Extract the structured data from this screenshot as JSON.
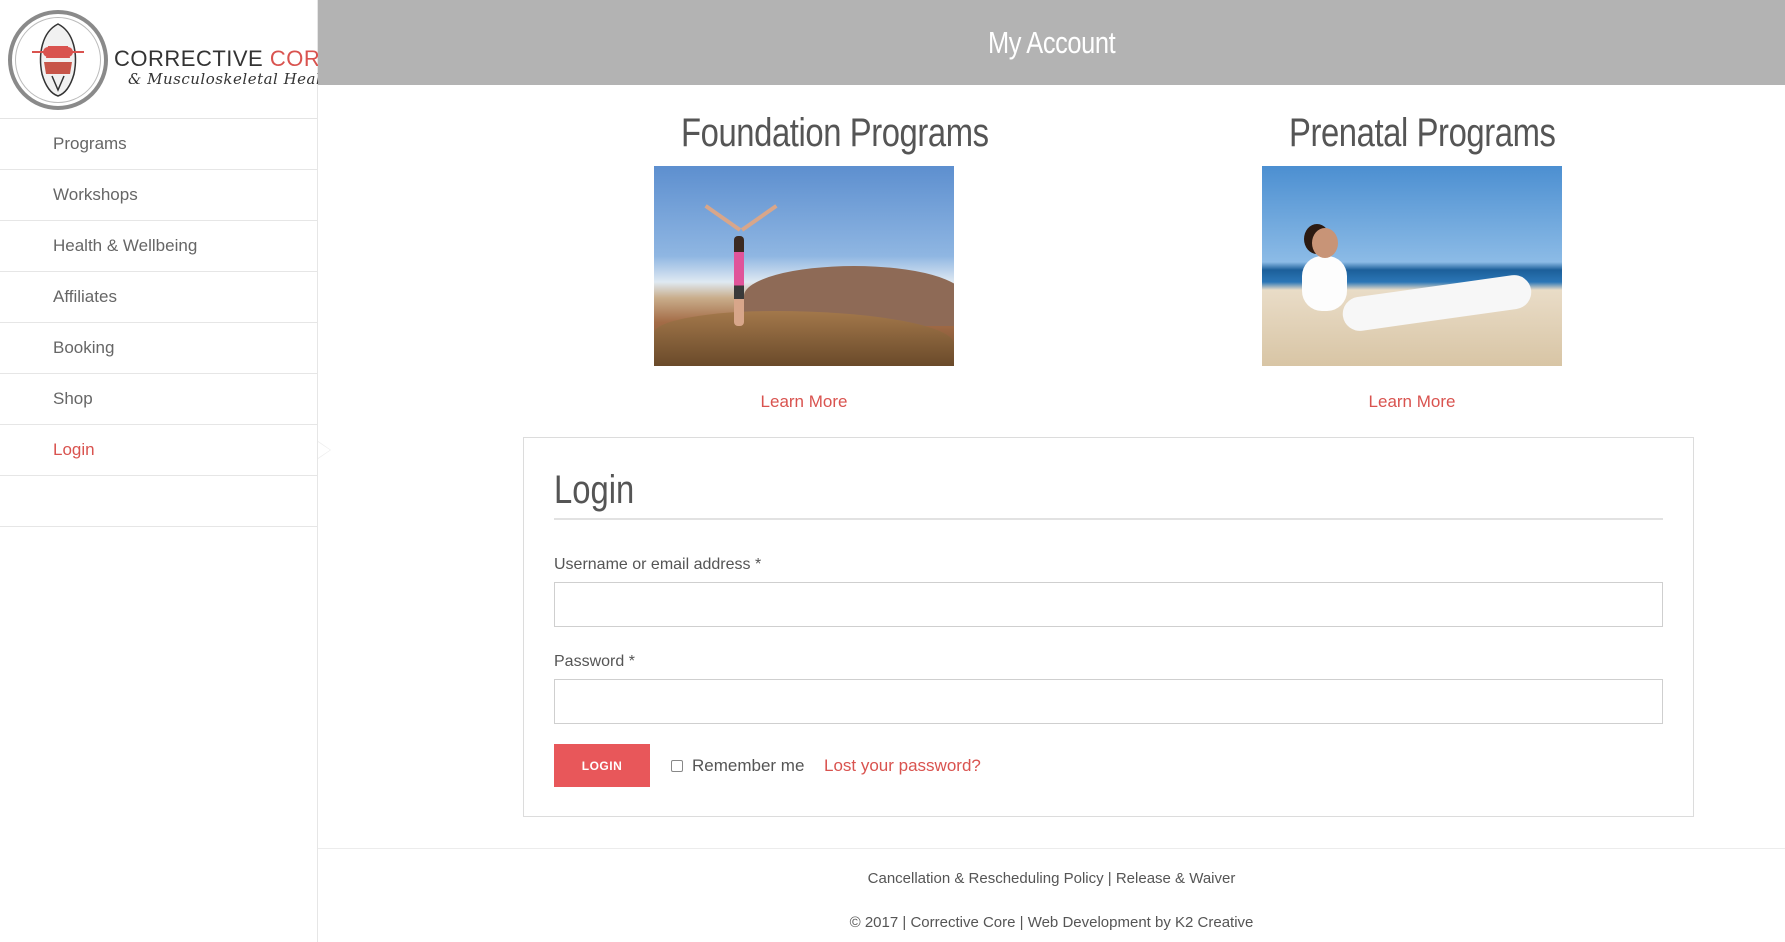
{
  "brand": {
    "name_part1": "CORRECTIVE ",
    "name_part2": "CORE",
    "tagline": "& Musculoskeletal Health"
  },
  "sidebar": {
    "items": [
      {
        "label": "Programs"
      },
      {
        "label": "Workshops"
      },
      {
        "label": "Health & Wellbeing"
      },
      {
        "label": "Affiliates"
      },
      {
        "label": "Booking"
      },
      {
        "label": "Shop"
      },
      {
        "label": "Login"
      }
    ],
    "active": "Login"
  },
  "header": {
    "title": "My Account"
  },
  "programs": [
    {
      "title": "Foundation Programs",
      "link": "Learn More"
    },
    {
      "title": "Prenatal Programs",
      "link": "Learn More"
    }
  ],
  "login": {
    "heading": "Login",
    "username_label": "Username or email address *",
    "username_value": "",
    "password_label": "Password *",
    "password_value": "",
    "button": "LOGIN",
    "remember": "Remember me",
    "lost": "Lost your password?"
  },
  "footer": {
    "link1": "Cancellation & Rescheduling Policy",
    "sep": " | ",
    "link2": "Release & Waiver",
    "copyright": "© 2017 | Corrective Core | Web Development by K2 Creative"
  },
  "colors": {
    "accent": "#d9534f",
    "button": "#e8575a",
    "header_bg": "#b3b3b3"
  }
}
